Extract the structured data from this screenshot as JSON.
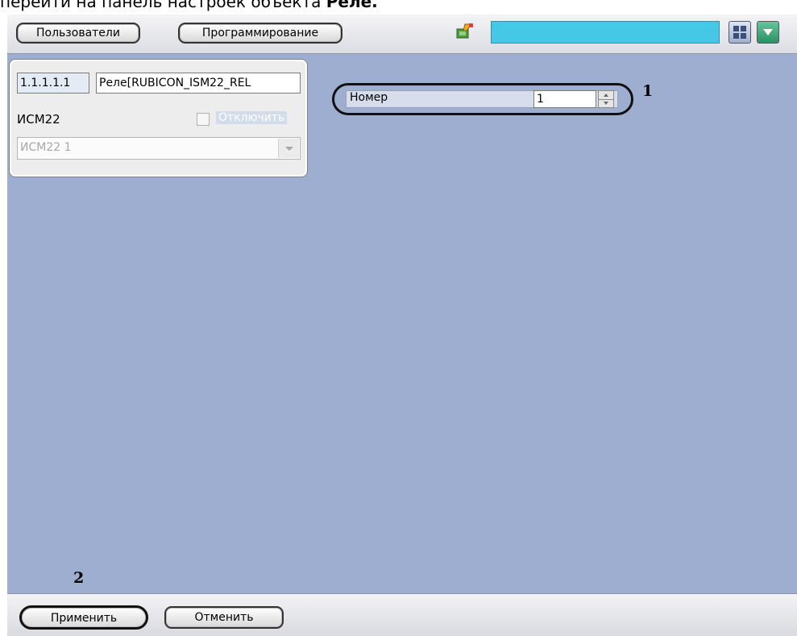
{
  "caption": {
    "text": "перейти на панель настроек объекта ",
    "bold": "Реле."
  },
  "toolbar": {
    "users_label": "Пользователи",
    "programming_label": "Программирование"
  },
  "object_panel": {
    "id_value": "1.1.1.1.1",
    "name_value": "Реле[RUBICON_ISM22_REL",
    "type_label": "ИСМ22",
    "disable_label": "Отключить",
    "parent_value": "ИСМ22 1"
  },
  "settings": {
    "number_label": "Номер",
    "number_value": "1"
  },
  "annotations": {
    "marker_1": "1",
    "marker_2": "2"
  },
  "footer": {
    "apply_label": "Применить",
    "cancel_label": "Отменить"
  },
  "colors": {
    "background": "#9eaed0",
    "accent_cyan": "#45c8e6"
  }
}
